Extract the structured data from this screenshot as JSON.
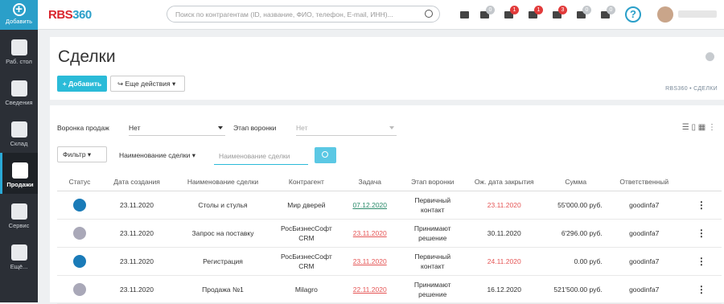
{
  "sidebar": {
    "add_label": "Добавить",
    "items": [
      {
        "label": "Раб. стол",
        "icon": "pie-chart-icon"
      },
      {
        "label": "Сведения",
        "icon": "id-card-icon"
      },
      {
        "label": "Склад",
        "icon": "cubes-icon"
      },
      {
        "label": "Продажи",
        "icon": "cart-icon",
        "active": true
      },
      {
        "label": "Сервис",
        "icon": "wrench-icon"
      },
      {
        "label": "Ещё...",
        "icon": "grid-icon"
      }
    ]
  },
  "header": {
    "logo_a": "RBS",
    "logo_b": "360",
    "search_placeholder": "Поиск по контрагентам (ID, название, ФИО, телефон, E-mail, ИНН)...",
    "badges": [
      "0",
      "1",
      "1",
      "3",
      "0",
      "0"
    ],
    "help": "?"
  },
  "page": {
    "title": "Сделки",
    "add_button": "Добавить",
    "more_button": "Еще действия",
    "breadcrumb": "RBS360 • СДЕЛКИ"
  },
  "filters": {
    "funnel_label": "Воронка продаж",
    "funnel_value": "Нет",
    "stage_label": "Этап воронки",
    "stage_value": "Нет",
    "filter_button": "Фильтр",
    "field_select": "Наименование сделки",
    "field_placeholder": "Наименование сделки"
  },
  "table": {
    "columns": [
      "Статус",
      "Дата создания",
      "Наименование сделки",
      "Контрагент",
      "Задача",
      "Этап воронки",
      "Ож. дата закрытия",
      "Сумма",
      "Ответственный",
      ""
    ],
    "rows": [
      {
        "status_color": "#1a7bb8",
        "created": "23.11.2020",
        "name": "Столы и стулья",
        "contractor": "Мир дверей",
        "task": "07.12.2020",
        "task_style": "green",
        "stage": "Первичный контакт",
        "close": "23.11.2020",
        "close_red": true,
        "sum": "55'000.00 руб.",
        "owner": "goodinfa7"
      },
      {
        "status_color": "#a9a8b8",
        "created": "23.11.2020",
        "name": "Запрос на поставку",
        "contractor": "РосБизнесСофт CRM",
        "task": "23.11.2020",
        "task_style": "red",
        "stage": "Принимают решение",
        "close": "30.11.2020",
        "close_red": false,
        "sum": "6'296.00 руб.",
        "owner": "goodinfa7"
      },
      {
        "status_color": "#1a7bb8",
        "created": "23.11.2020",
        "name": "Регистрация",
        "contractor": "РосБизнесСофт CRM",
        "task": "23.11.2020",
        "task_style": "red",
        "stage": "Первичный контакт",
        "close": "24.11.2020",
        "close_red": true,
        "sum": "0.00 руб.",
        "owner": "goodinfa7"
      },
      {
        "status_color": "#a9a8b8",
        "created": "23.11.2020",
        "name": "Продажа №1",
        "contractor": "Milagro",
        "task": "22.11.2020",
        "task_style": "red",
        "stage": "Принимают решение",
        "close": "16.12.2020",
        "close_red": false,
        "sum": "521'500.00 руб.",
        "owner": "goodinfa7"
      }
    ]
  }
}
